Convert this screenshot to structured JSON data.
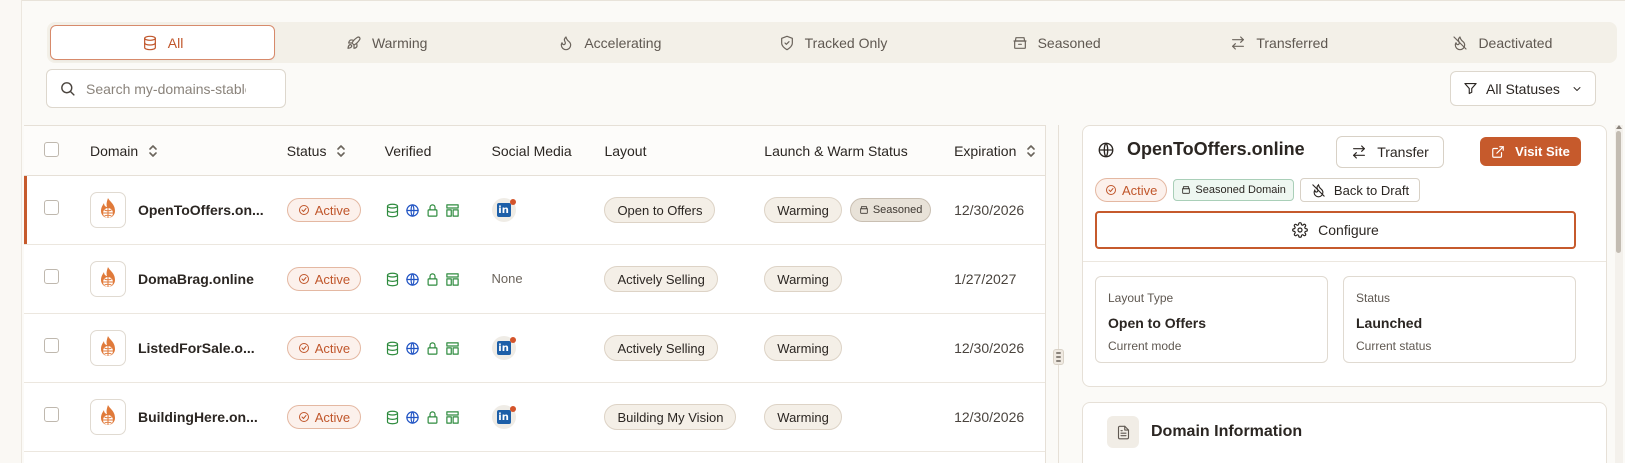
{
  "filters": [
    {
      "label": "All",
      "icon": "database-icon",
      "active": true
    },
    {
      "label": "Warming",
      "icon": "rocket-icon",
      "active": false
    },
    {
      "label": "Accelerating",
      "icon": "flame-icon",
      "active": false
    },
    {
      "label": "Tracked Only",
      "icon": "shield-check-icon",
      "active": false
    },
    {
      "label": "Seasoned",
      "icon": "archive-icon",
      "active": false
    },
    {
      "label": "Transferred",
      "icon": "arrows-swap-icon",
      "active": false
    },
    {
      "label": "Deactivated",
      "icon": "flame-off-icon",
      "active": false
    }
  ],
  "search": {
    "placeholder": "Search my-domains-stable"
  },
  "status_filter": {
    "label": "All Statuses"
  },
  "table": {
    "headers": {
      "domain": "Domain",
      "status": "Status",
      "verified": "Verified",
      "social": "Social Media",
      "layout": "Layout",
      "launch": "Launch & Warm Status",
      "expiration": "Expiration"
    },
    "rows": [
      {
        "domain": "OpenToOffers.on...",
        "status": "Active",
        "social": "linkedin",
        "layout": "Open to Offers",
        "launch": "Warming",
        "extra": "Seasoned",
        "expiration": "12/30/2026"
      },
      {
        "domain": "DomaBrag.online",
        "status": "Active",
        "social": "None",
        "layout": "Actively Selling",
        "launch": "Warming",
        "extra": "",
        "expiration": "1/27/2027"
      },
      {
        "domain": "ListedForSale.o...",
        "status": "Active",
        "social": "linkedin",
        "layout": "Actively Selling",
        "launch": "Warming",
        "extra": "",
        "expiration": "12/30/2026"
      },
      {
        "domain": "BuildingHere.on...",
        "status": "Active",
        "social": "linkedin",
        "layout": "Building My Vision",
        "launch": "Warming",
        "extra": "",
        "expiration": "12/30/2026"
      }
    ]
  },
  "detail": {
    "title": "OpenToOffers.online",
    "transfer_label": "Transfer",
    "visit_label": "Visit Site",
    "status_tag": "Active",
    "seasoned_tag": "Seasoned Domain",
    "draft_label": "Back to Draft",
    "configure_label": "Configure",
    "cards": [
      {
        "label": "Layout Type",
        "value": "Open to Offers",
        "sub": "Current mode"
      },
      {
        "label": "Status",
        "value": "Launched",
        "sub": "Current status"
      }
    ],
    "section_title": "Domain Information"
  },
  "colors": {
    "accent": "#c65a2c",
    "verified_green": "#2e8b3e",
    "verified_blue": "#2255c4"
  }
}
